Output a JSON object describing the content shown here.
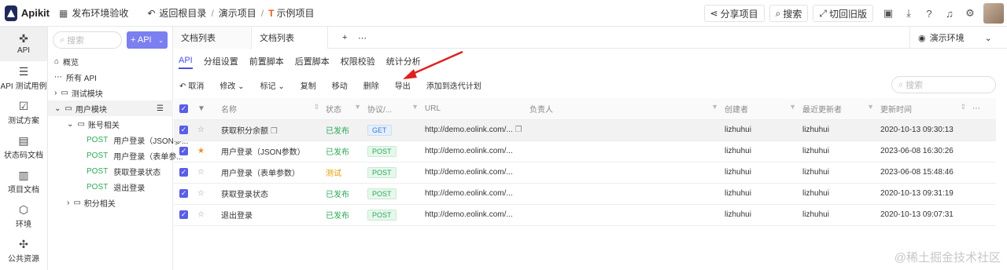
{
  "topbar": {
    "app_name": "Apikit",
    "release_btn": "发布环境验收",
    "back_root": "返回根目录",
    "crumb1": "演示项目",
    "crumb2": "示例项目",
    "share": "分享项目",
    "search": "搜索",
    "old_version": "切回旧版"
  },
  "leftnav": [
    {
      "label": "API",
      "icon": "api-icon"
    },
    {
      "label": "API 测试用例",
      "icon": "test-case-icon"
    },
    {
      "label": "测试方案",
      "icon": "test-plan-icon"
    },
    {
      "label": "状态码文档",
      "icon": "status-doc-icon"
    },
    {
      "label": "项目文档",
      "icon": "project-doc-icon"
    },
    {
      "label": "环境",
      "icon": "env-icon"
    },
    {
      "label": "公共资源",
      "icon": "resource-icon"
    }
  ],
  "tree": {
    "search_placeholder": "搜索",
    "api_button": "+ API",
    "overview": "概览",
    "all_api": "所有 API",
    "group_test": "测试模块",
    "group_user": "用户模块",
    "sub_account": "账号相关",
    "items": [
      {
        "method": "POST",
        "label": "用户登录（JSON参..."
      },
      {
        "method": "POST",
        "label": "用户登录（表单参..."
      },
      {
        "method": "POST",
        "label": "获取登录状态"
      },
      {
        "method": "POST",
        "label": "退出登录"
      }
    ],
    "sub_points": "积分相关"
  },
  "tabs": [
    "文档列表",
    "文档列表"
  ],
  "env": "演示环境",
  "subtabs": [
    "API",
    "分组设置",
    "前置脚本",
    "后置脚本",
    "权限校验",
    "统计分析"
  ],
  "toolbar": [
    "取消",
    "修改",
    "标记",
    "复制",
    "移动",
    "删除",
    "导出",
    "添加到迭代计划"
  ],
  "right_search_placeholder": "搜索",
  "table": {
    "headers": {
      "name": "名称",
      "status": "状态",
      "protocol": "协议/...",
      "url": "URL",
      "owner": "负责人",
      "creator": "创建者",
      "updater": "最近更新者",
      "time": "更新时间"
    },
    "rows": [
      {
        "star": false,
        "name": "获取积分余额",
        "status": "已发布",
        "status_type": "ok",
        "method": "GET",
        "url": "http://demo.eolink.com/...",
        "creator": "lizhuhui",
        "updater": "lizhuhui",
        "time": "2020-10-13 09:30:13"
      },
      {
        "star": true,
        "name": "用户登录（JSON参数）",
        "status": "已发布",
        "status_type": "ok",
        "method": "POST",
        "url": "http://demo.eolink.com/...",
        "creator": "lizhuhui",
        "updater": "lizhuhui",
        "time": "2023-06-08 16:30:26"
      },
      {
        "star": false,
        "name": "用户登录（表单参数）",
        "status": "测试",
        "status_type": "test",
        "method": "POST",
        "url": "http://demo.eolink.com/...",
        "creator": "lizhuhui",
        "updater": "lizhuhui",
        "time": "2023-06-08 15:48:46"
      },
      {
        "star": false,
        "name": "获取登录状态",
        "status": "已发布",
        "status_type": "ok",
        "method": "POST",
        "url": "http://demo.eolink.com/...",
        "creator": "lizhuhui",
        "updater": "lizhuhui",
        "time": "2020-10-13 09:31:19"
      },
      {
        "star": false,
        "name": "退出登录",
        "status": "已发布",
        "status_type": "ok",
        "method": "POST",
        "url": "http://demo.eolink.com/...",
        "creator": "lizhuhui",
        "updater": "lizhuhui",
        "time": "2020-10-13 09:07:31"
      }
    ]
  },
  "watermark": "@稀土掘金技术社区",
  "colors": {
    "accent": "#5a5ee6",
    "success": "#2fa85a",
    "warning": "#e0a000",
    "arrow": "#e02020"
  }
}
